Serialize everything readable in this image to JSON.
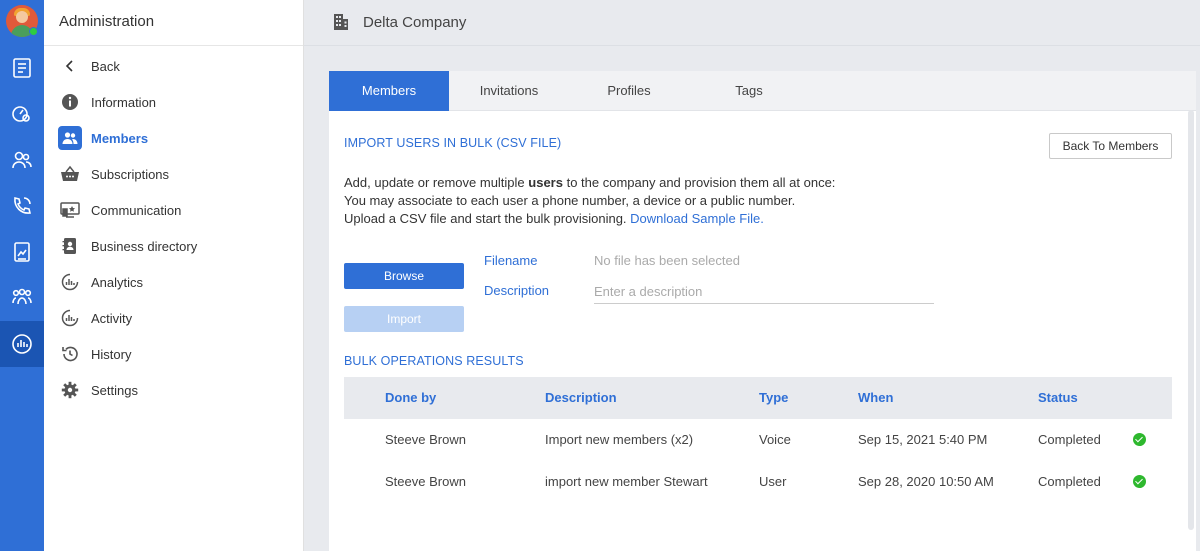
{
  "sidebar": {
    "title": "Administration",
    "items": [
      {
        "label": "Back",
        "icon": "chevron-left-icon"
      },
      {
        "label": "Information",
        "icon": "info-icon"
      },
      {
        "label": "Members",
        "icon": "members-icon"
      },
      {
        "label": "Subscriptions",
        "icon": "basket-icon"
      },
      {
        "label": "Communication",
        "icon": "communication-icon"
      },
      {
        "label": "Business directory",
        "icon": "directory-icon"
      },
      {
        "label": "Analytics",
        "icon": "analytics-icon"
      },
      {
        "label": "Activity",
        "icon": "activity-icon"
      },
      {
        "label": "History",
        "icon": "history-icon"
      },
      {
        "label": "Settings",
        "icon": "gear-icon"
      }
    ],
    "active": "Members"
  },
  "header": {
    "title": "Delta Company",
    "icon": "building-icon"
  },
  "tabs": [
    {
      "label": "Members"
    },
    {
      "label": "Invitations"
    },
    {
      "label": "Profiles"
    },
    {
      "label": "Tags"
    }
  ],
  "import": {
    "title": "IMPORT USERS IN BULK (CSV FILE)",
    "back_button": "Back To Members",
    "line1_pre": "Add, update or remove multiple ",
    "line1_bold": "users",
    "line1_post": " to the company and provision them all at once:",
    "line2": "You may associate to each user a phone number, a device or a public number.",
    "line3_pre": "Upload a CSV file and start the bulk provisioning. ",
    "line3_link": "Download Sample File.",
    "browse_label": "Browse",
    "import_label": "Import",
    "filename_label": "Filename",
    "filename_value": "No file has been selected",
    "description_label": "Description",
    "description_placeholder": "Enter a description"
  },
  "results": {
    "title": "BULK OPERATIONS RESULTS",
    "columns": [
      "Done by",
      "Description",
      "Type",
      "When",
      "Status"
    ],
    "rows": [
      {
        "done_by": "Steeve Brown",
        "description": "Import new members (x2)",
        "type": "Voice",
        "when": "Sep 15, 2021 5:40 PM",
        "status": "Completed"
      },
      {
        "done_by": "Steeve Brown",
        "description": "import new member Stewart",
        "type": "User",
        "when": "Sep 28, 2020 10:50 AM",
        "status": "Completed"
      }
    ]
  },
  "colors": {
    "accent": "#2f6fd6",
    "success": "#2eb82e"
  }
}
